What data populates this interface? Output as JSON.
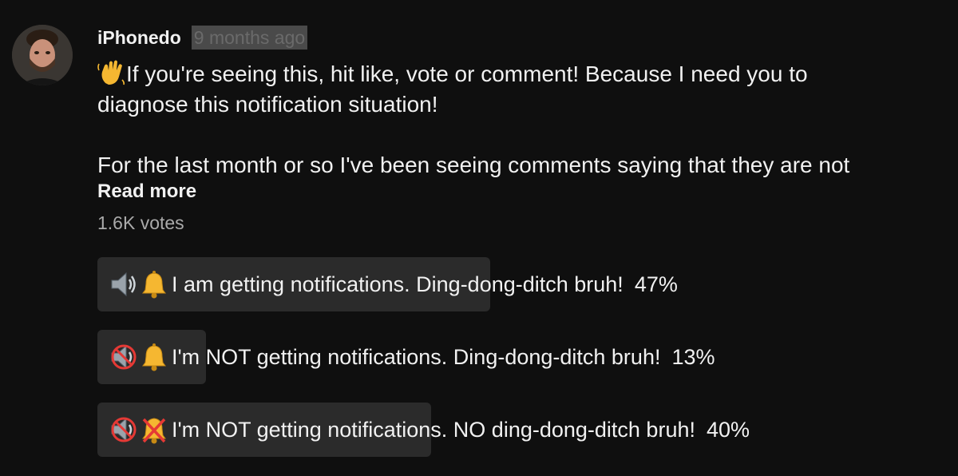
{
  "post": {
    "author": "iPhonedo",
    "timestamp": "9 months ago",
    "body_line1": "If you're seeing this, hit like, vote or comment! Because I need you to",
    "body_line2": "diagnose this notification situation!",
    "body_line3": "For the last month or so I've been seeing comments saying that they are not",
    "read_more": "Read more",
    "votes": "1.6K votes"
  },
  "poll": {
    "options": [
      {
        "label": "I am getting notifications. Ding-dong-ditch bruh!",
        "percent": "47%",
        "fraction": 0.47,
        "icons": [
          "speaker-icon",
          "bell-icon"
        ]
      },
      {
        "label": "I'm NOT getting notifications. Ding-dong-ditch bruh!",
        "percent": "13%",
        "fraction": 0.13,
        "icons": [
          "muted-speaker-icon",
          "bell-icon"
        ]
      },
      {
        "label": "I'm NOT getting notifications. NO ding-dong-ditch bruh!",
        "percent": "40%",
        "fraction": 0.4,
        "icons": [
          "muted-speaker-icon",
          "no-bell-icon"
        ]
      }
    ]
  },
  "colors": {
    "background": "#0f0f0f",
    "text": "#f1f1f1",
    "secondary_text": "#aaaaaa",
    "poll_bar": "#2b2b2b"
  }
}
